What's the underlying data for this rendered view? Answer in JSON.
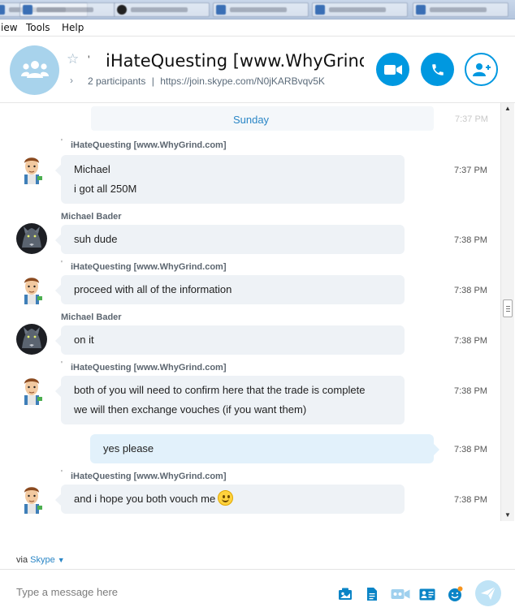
{
  "menu": {
    "items": [
      "iew",
      "Tools",
      "Help"
    ]
  },
  "header": {
    "title": "iHateQuesting [www.WhyGrind....",
    "tick": "'",
    "participants": "2 participants",
    "separator": "|",
    "link": "https://join.skype.com/N0jKARBvqv5K"
  },
  "chat": {
    "day": "Sunday",
    "ghost_time": "7:37 PM",
    "messages": [
      {
        "sender": "iHateQuesting [www.WhyGrind.com]",
        "lines": [
          "Michael",
          "i got all 250M"
        ],
        "time": "7:37 PM",
        "avatar": "cartoon-avatar"
      },
      {
        "sender": "Michael Bader",
        "lines": [
          "suh dude"
        ],
        "time": "7:38 PM",
        "avatar": "werewolf-avatar"
      },
      {
        "sender": "iHateQuesting [www.WhyGrind.com]",
        "lines": [
          "proceed with all of the information"
        ],
        "time": "7:38 PM",
        "avatar": "cartoon-avatar"
      },
      {
        "sender": "Michael Bader",
        "lines": [
          "on it"
        ],
        "time": "7:38 PM",
        "avatar": "werewolf-avatar"
      },
      {
        "sender": "iHateQuesting [www.WhyGrind.com]",
        "lines": [
          "both of you will need to confirm here that the trade is complete",
          "we will then exchange vouches (if you want them)"
        ],
        "time": "7:38 PM",
        "avatar": "cartoon-avatar"
      },
      {
        "sender": "",
        "lines": [
          "yes please"
        ],
        "time": "7:38 PM",
        "outgoing": true
      },
      {
        "sender": "iHateQuesting [www.WhyGrind.com]",
        "lines": [
          "and i hope you both vouch me"
        ],
        "time": "7:38 PM",
        "avatar": "cartoon-avatar",
        "emoji": "smiley-icon"
      }
    ]
  },
  "footer": {
    "via": "via",
    "via_app": "Skype",
    "placeholder": "Type a message here"
  },
  "colors": {
    "accent": "#0098e0",
    "link": "#2a86c6",
    "bubble_in": "#eef2f6",
    "bubble_out": "#e2f1fb"
  }
}
